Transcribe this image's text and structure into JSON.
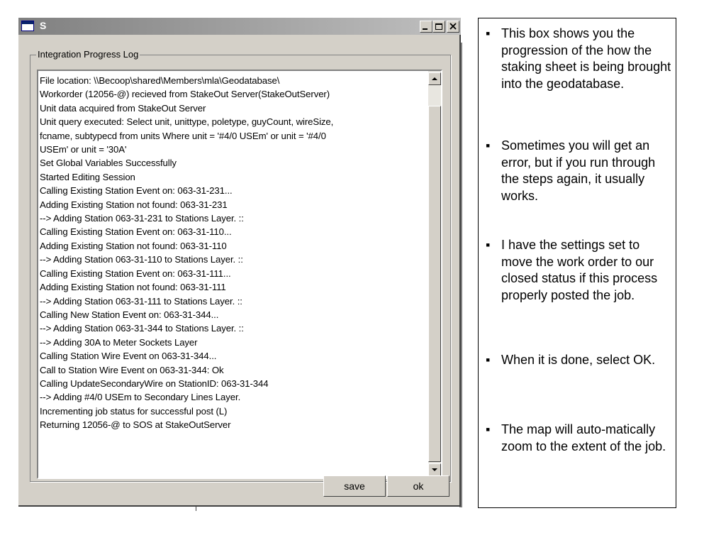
{
  "window": {
    "title": "S",
    "group_label": "Integration Progress Log",
    "log_lines": [
      "File location: \\\\Becoop\\shared\\Members\\mla\\Geodatabase\\",
      "Workorder (12056-@) recieved from StakeOut Server(StakeOutServer)",
      "Unit data acquired from StakeOut Server",
      "Unit query executed: Select unit, unittype, poletype, guyCount, wireSize,",
      "fcname, subtypecd from units Where unit = '#4/0 USEm' or unit = '#4/0",
      "USEm' or unit = '30A'",
      "Set Global Variables Successfully",
      "Started Editing Session",
      "Calling Existing Station Event on: 063-31-231...",
      "Adding Existing Station not found: 063-31-231",
      "--> Adding Station 063-31-231 to Stations Layer. ::",
      "Calling Existing Station Event on: 063-31-110...",
      "Adding Existing Station not found: 063-31-110",
      "--> Adding Station 063-31-110 to Stations Layer. ::",
      "Calling Existing Station Event on: 063-31-111...",
      "Adding Existing Station not found: 063-31-111",
      "--> Adding Station 063-31-111 to Stations Layer. ::",
      "Calling New Station Event on: 063-31-344...",
      "--> Adding Station 063-31-344 to Stations Layer. ::",
      "--> Adding 30A to Meter Sockets Layer",
      "Calling Station Wire Event on 063-31-344...",
      "Call to Station Wire Event on 063-31-344: Ok",
      "Calling UpdateSecondaryWire on StationID: 063-31-344",
      "--> Adding #4/0 USEm to Secondary Lines Layer.",
      "Incrementing job status for successful post (L)",
      "Returning 12056-@ to SOS at StakeOutServer"
    ],
    "buttons": {
      "save": "save",
      "ok": "ok"
    }
  },
  "notes": [
    "This box shows you the progression of the how the staking sheet is being brought into the geodatabase.",
    "Sometimes you will get an error, but if you run through the steps again, it usually works.",
    "I have the settings set to move the work order to our closed status if this process properly posted the job.",
    "When it is done, select OK.",
    "The map will auto-matically zoom to the extent of the job."
  ],
  "bullet": "▪"
}
